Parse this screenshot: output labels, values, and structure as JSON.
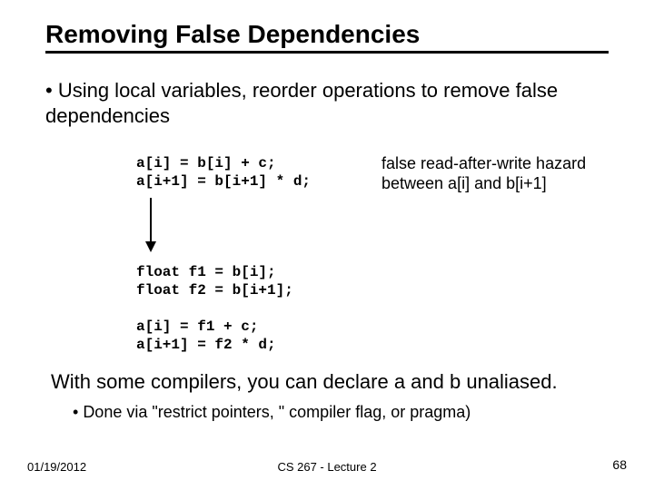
{
  "title": "Removing False Dependencies",
  "bullet_main": "Using local variables, reorder operations to remove false dependencies",
  "code": {
    "block1": "a[i] = b[i] + c;\na[i+1] = b[i+1] * d;",
    "block2": "float f1 = b[i];\nfloat f2 = b[i+1];",
    "block3": "a[i] = f1 + c;\na[i+1] = f2 * d;"
  },
  "hazard_note": "false read-after-write hazard between a[i] and b[i+1]",
  "closing_line": "With some compilers, you can declare a and b unaliased.",
  "sub_bullet": "Done via \"restrict pointers, \" compiler flag, or pragma)",
  "footer": {
    "date": "01/19/2012",
    "center": "CS 267 - Lecture 2",
    "page": "68"
  }
}
